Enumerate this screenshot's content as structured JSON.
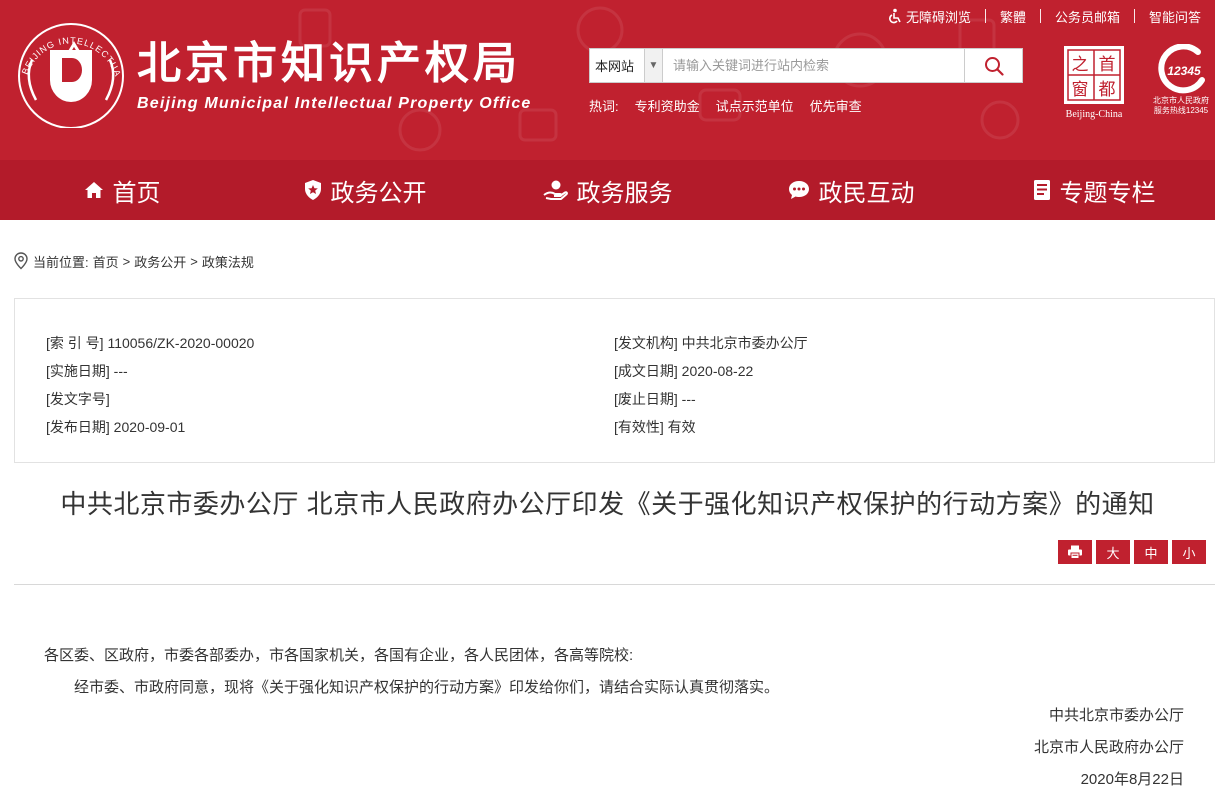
{
  "header": {
    "top_links": [
      {
        "label": "无障碍浏览",
        "icon": "accessibility-icon"
      },
      {
        "label": "繁體"
      },
      {
        "label": "公务员邮箱"
      },
      {
        "label": "智能问答"
      }
    ],
    "title": "北京市知识产权局",
    "subtitle": "Beijing Municipal Intellectual Property Office",
    "emblem_text": "BEIJING INTELLECTUAL PROPERTY",
    "search": {
      "scope": "本网站",
      "placeholder": "请输入关键词进行站内检索"
    },
    "hotwords_label": "热词:",
    "hotwords": [
      "专利资助金",
      "试点示范单位",
      "优先审查"
    ],
    "capital_logo": {
      "chars": [
        "之",
        "首",
        "窗",
        "都"
      ],
      "label": "Beijing-China"
    },
    "hotline": {
      "number": "12345",
      "line1": "北京市人民政府",
      "line2": "服务热线12345"
    }
  },
  "nav": [
    {
      "label": "首页",
      "icon": "home-icon"
    },
    {
      "label": "政务公开",
      "icon": "shield-icon"
    },
    {
      "label": "政务服务",
      "icon": "service-hand-icon"
    },
    {
      "label": "政民互动",
      "icon": "chat-icon"
    },
    {
      "label": "专题专栏",
      "icon": "bookmark-icon"
    }
  ],
  "breadcrumb": {
    "prefix": "当前位置:",
    "items": [
      "首页",
      "政务公开",
      "政策法规"
    ],
    "separator": ">"
  },
  "meta": {
    "left": [
      "[索 引 号] 110056/ZK-2020-00020",
      "[实施日期] ---",
      "[发文字号]",
      "[发布日期] 2020-09-01"
    ],
    "right": [
      "[发文机构] 中共北京市委办公厅",
      "[成文日期] 2020-08-22",
      "[废止日期] ---",
      "[有效性] 有效"
    ]
  },
  "article": {
    "title": "中共北京市委办公厅 北京市人民政府办公厅印发《关于强化知识产权保护的行动方案》的通知",
    "tools": {
      "large": "大",
      "medium": "中",
      "small": "小"
    },
    "salutation": "各区委、区政府，市委各部委办，市各国家机关，各国有企业，各人民团体，各高等院校:",
    "paragraph": "经市委、市政府同意，现将《关于强化知识产权保护的行动方案》印发给你们，请结合实际认真贯彻落实。",
    "signatures": [
      "中共北京市委办公厅",
      "北京市人民政府办公厅",
      "2020年8月22日"
    ]
  },
  "colors": {
    "brand": "#c0212f",
    "nav": "#b31b2a"
  }
}
